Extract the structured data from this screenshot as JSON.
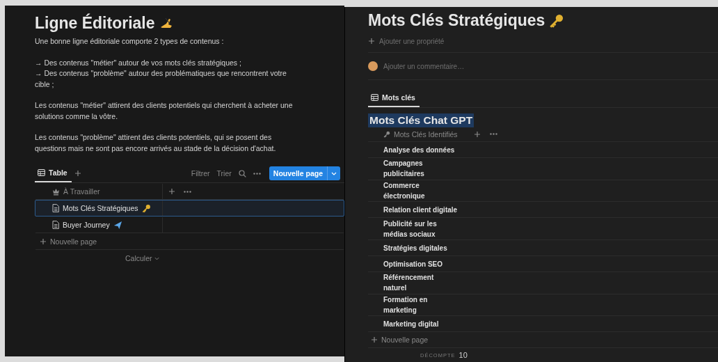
{
  "left_page": {
    "title": "Ligne Éditoriale",
    "paragraphs": [
      [
        "Une bonne ligne éditoriale comporte 2 types de contenus :"
      ],
      [
        "→ Des contenus \"métier\" autour de vos mots clés stratégiques ;",
        "→ Des contenus \"problème\" autour des problématiques que rencontrent votre cible ;"
      ],
      [
        "Les contenus \"métier\" attirent des clients potentiels qui cherchent à acheter une solutions comme la vôtre."
      ],
      [
        "Les contenus \"problème\" attirent des clients potentiels, qui se posent des questions mais ne sont pas encore arrivés au stade de la décision d'achat."
      ]
    ],
    "database": {
      "views": [
        {
          "label": "Table",
          "selected": true
        }
      ],
      "toolbar": [
        "Filtrer",
        "Trier"
      ],
      "new_button": "Nouvelle page",
      "column": "À Travailler",
      "rows": [
        {
          "title": "Mots Clés Stratégiques",
          "kind": "key",
          "selected": true
        },
        {
          "title": "Buyer Journey",
          "kind": "plane",
          "selected": false
        }
      ],
      "add_row": "Nouvelle page",
      "calculate": "Calculer"
    }
  },
  "right_page": {
    "title": "Mots Clés Stratégiques",
    "add_property": "Ajouter une propriété",
    "comment_placeholder": "Ajouter un commentaire…",
    "views": [
      {
        "label": "Mots clés",
        "selected": true
      }
    ],
    "heading": {
      "text": "Mots Clés Chat GPT",
      "highlighted": true
    },
    "column": "Mots Clés Identifiés",
    "rows": [
      "Analyse des données",
      "Campagnes publicitaires",
      "Commerce électronique",
      "Relation client digitale",
      "Publicité sur les médias sociaux",
      "Stratégies digitales",
      "Optimisation SEO",
      "Référencement naturel",
      "Formation en marketing",
      "Marketing digital"
    ],
    "add_row": "Nouvelle page",
    "count_label": "DÉCOMPTE",
    "count": "10"
  }
}
